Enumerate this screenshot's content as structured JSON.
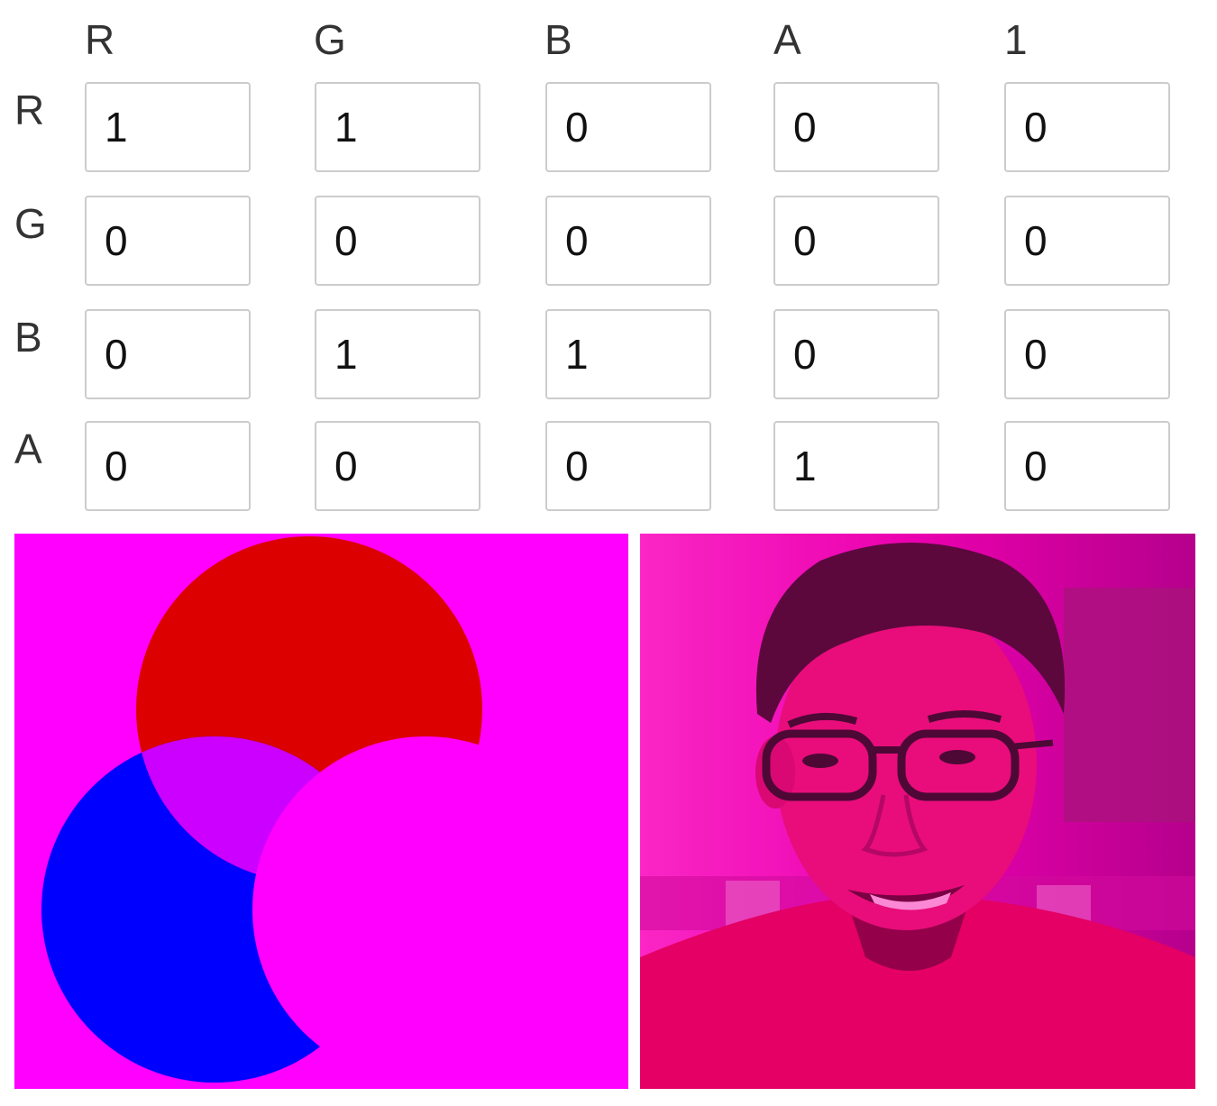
{
  "matrix": {
    "column_headers": [
      "R",
      "G",
      "B",
      "A",
      "1"
    ],
    "row_headers": [
      "R",
      "G",
      "B",
      "A"
    ],
    "values": [
      [
        "1",
        "1",
        "0",
        "0",
        "0"
      ],
      [
        "0",
        "0",
        "0",
        "0",
        "0"
      ],
      [
        "0",
        "1",
        "1",
        "0",
        "0"
      ],
      [
        "0",
        "0",
        "0",
        "1",
        "0"
      ]
    ]
  },
  "colors": {
    "background_tint": "#ff00ff",
    "red_circle": "#dd0000",
    "blue_circle": "#0000ff",
    "overlap_red_blue": "#cc00ff",
    "photo_tint": "#e0008c",
    "input_border": "#cccccc"
  },
  "icons": {
    "venn_image": "rgb-venn-diagram-filtered",
    "photo_image": "portrait-photo-filtered"
  }
}
